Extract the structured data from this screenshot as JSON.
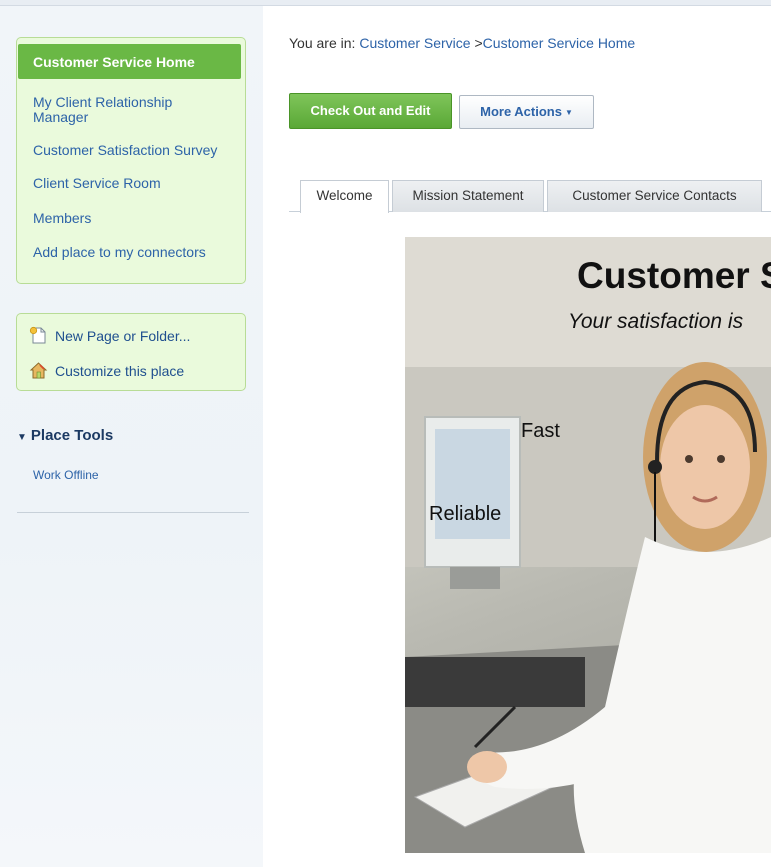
{
  "sidebar": {
    "nav": {
      "selected": "Customer Service Home",
      "items": [
        "My Client Relationship Manager",
        "Customer Satisfaction Survey",
        "Client Service Room",
        "Members",
        "Add place to my connectors"
      ]
    },
    "actions": {
      "new_page": "New Page or Folder...",
      "customize": "Customize this place"
    },
    "place_tools": {
      "heading": "Place Tools",
      "work_offline": "Work Offline"
    }
  },
  "breadcrumb": {
    "prefix": "You are in: ",
    "parent": "Customer Service",
    "separator": " >",
    "current": "Customer Service Home"
  },
  "toolbar": {
    "check_out": "Check Out and Edit",
    "more_actions": "More Actions"
  },
  "tabs": [
    "Welcome",
    "Mission Statement",
    "Customer Service Contacts"
  ],
  "hero": {
    "title": "Customer S",
    "subtitle": "Your satisfaction is",
    "label_fast": "Fast",
    "label_reliable": "Reliable"
  },
  "colors": {
    "accent_green": "#6ab845",
    "link_blue": "#2d63a8",
    "panel_green": "#eafadc"
  }
}
